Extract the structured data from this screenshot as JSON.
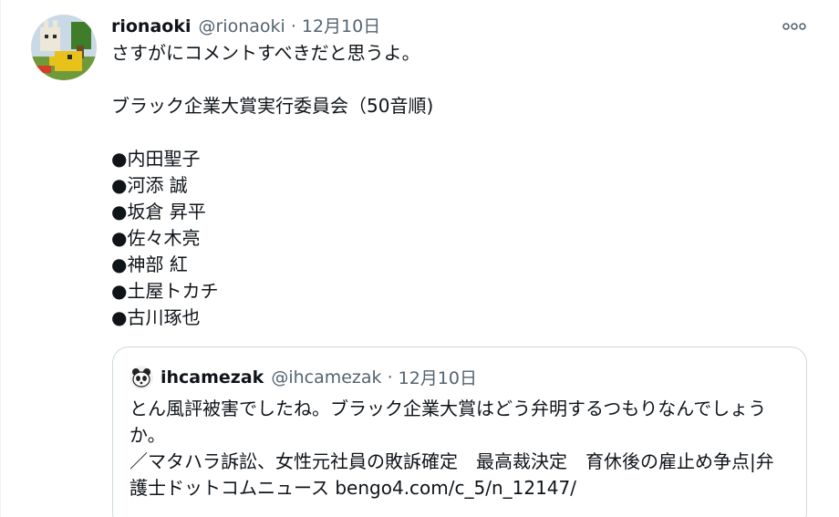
{
  "tweet": {
    "display_name": "rionaoki",
    "handle": "@rionaoki",
    "separator": "·",
    "date": "12月10日",
    "text": "さすがにコメントすべきだと思うよ。\n\nブラック企業大賞実行委員会（50音順)\n\n●内田聖子\n●河添 誠\n●坂倉 昇平\n●佐々木亮\n●神部 紅\n●土屋トカチ\n●古川琢也",
    "more_icon": "more-horizontal-icon"
  },
  "quote": {
    "display_name": "ihcamezak",
    "handle": "@ihcamezak",
    "separator": "·",
    "date": "12月10日",
    "text": "とん風評被害でしたね。ブラック企業大賞はどう弁明するつもりなんでしょうか。\n／マタハラ訴訟、女性元社員の敗訴確定　最高裁決定　育休後の雇止め争点|弁護士ドットコムニュース bengo4.com/c_5/n_12147/"
  },
  "colors": {
    "text_primary": "#0f1419",
    "text_secondary": "#536471",
    "border": "#cfd9de"
  }
}
